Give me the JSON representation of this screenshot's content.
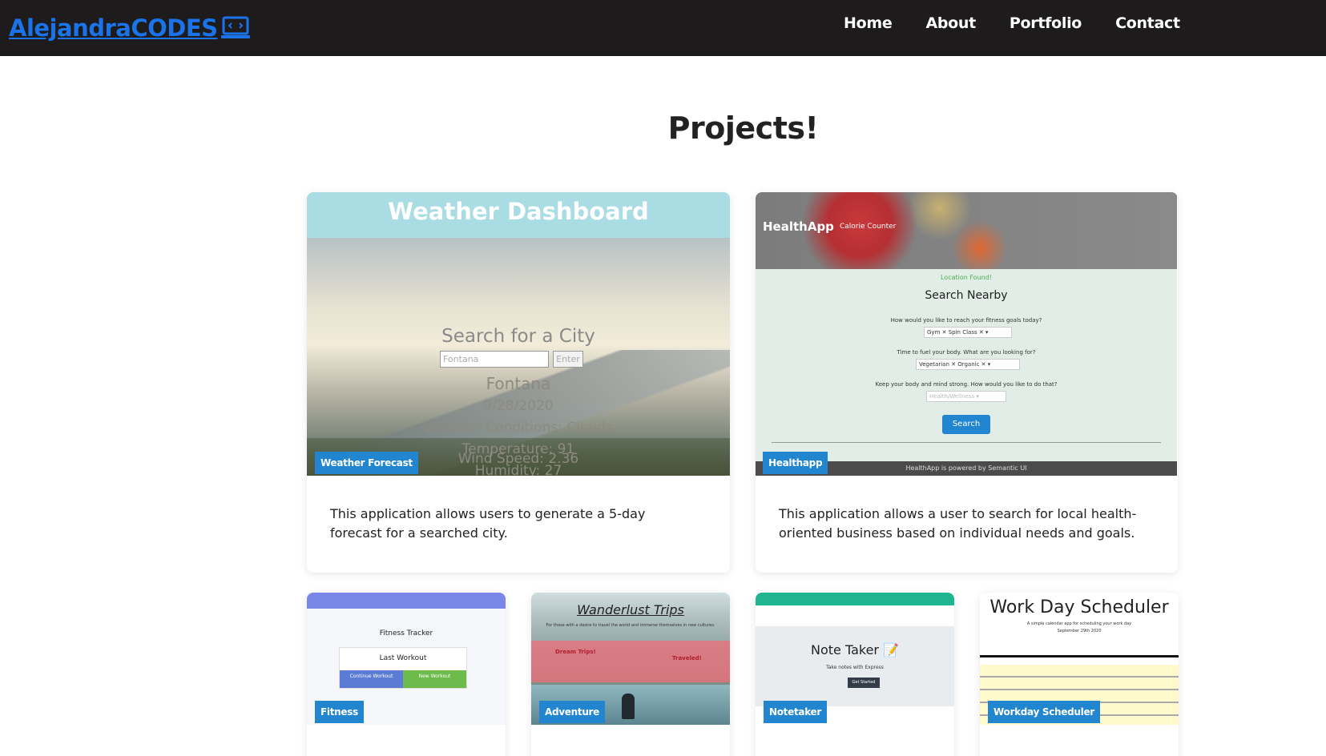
{
  "navbar": {
    "brand": "AlejandraCODES",
    "links": [
      "Home",
      "About",
      "Portfolio",
      "Contact"
    ]
  },
  "page_title": "Projects!",
  "projects": {
    "weather": {
      "tag": "Weather Forecast",
      "description": "This application allows users to generate a 5-day forecast for a searched city.",
      "screenshot": {
        "header": "Weather Dashboard",
        "search_title": "Search for a City",
        "input_value": "Fontana",
        "button": "Enter",
        "city": "Fontana",
        "date": "9/28/2020",
        "conditions": "Weather Conditions: Clouds",
        "temperature": "Temperature: 91",
        "humidity": "Humidity: 27",
        "wind": "Wind Speed: 2.36"
      }
    },
    "health": {
      "tag": "Healthapp",
      "description": "This application allows a user to search for local health-oriented business based on individual needs and goals.",
      "screenshot": {
        "brand": "HealthApp",
        "subtitle": "Calorie Counter",
        "status": "Location Found!",
        "title": "Search Nearby",
        "q1": "How would you like to reach your fitness goals today?",
        "q1_chips": "Gym ✕  Spin Class ✕  ▾",
        "q2": "Time to fuel your body. What are you looking for?",
        "q2_chips": "Vegetarian ✕  Organic ✕  ▾",
        "q3": "Keep your body and mind strong. How would you like to do that?",
        "q3_placeholder": "Health/Wellness  ▾",
        "button": "Search",
        "footer": "HealthApp is powered by Semantic UI"
      }
    },
    "fitness": {
      "tag": "Fitness",
      "screenshot": {
        "title": "Fitness Tracker",
        "card_title": "Last Workout",
        "btn_continue": "Continue Workout",
        "btn_new": "New Workout"
      }
    },
    "adventure": {
      "tag": "Adventure",
      "screenshot": {
        "title": "Wanderlust Trips",
        "subtitle": "For those with a desire to travel the world and immerse themselves in new cultures.",
        "left": "Dream Trips!",
        "right": "Traveled!"
      }
    },
    "notetaker": {
      "tag": "Notetaker",
      "screenshot": {
        "title": "Note Taker 📝",
        "subtitle": "Take notes with Express",
        "button": "Get Started"
      }
    },
    "workday": {
      "tag": "Workday Scheduler",
      "screenshot": {
        "title": "Work Day Scheduler",
        "subtitle": "A simple calendar app for scheduling your work day",
        "date": "September 29th 2020"
      }
    }
  },
  "colors": {
    "navbar_bg": "#1d1b1b",
    "brand": "#1a73e8",
    "tag_bg": "#2185d0"
  },
  "icons": {
    "brand_icon": "laptop-code-icon"
  }
}
